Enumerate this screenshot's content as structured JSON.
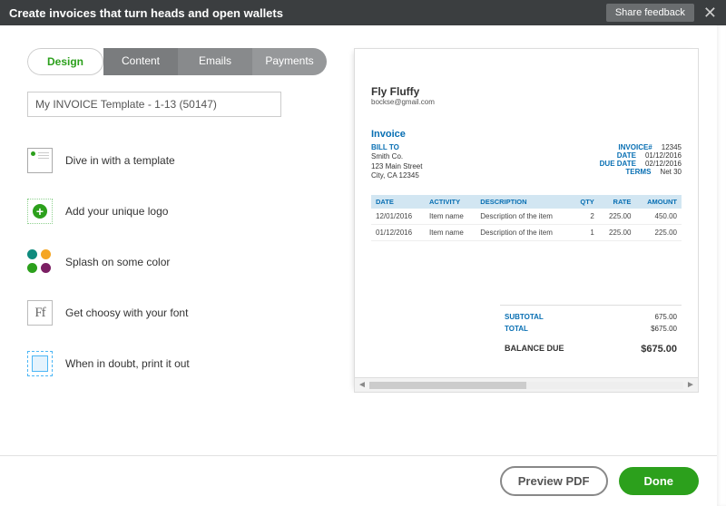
{
  "header": {
    "title": "Create invoices that turn heads and open wallets",
    "share_label": "Share feedback"
  },
  "tabs": [
    "Design",
    "Content",
    "Emails",
    "Payments"
  ],
  "template_name": "My INVOICE Template - 1-13 (50147)",
  "options": [
    {
      "label": "Dive in with a template"
    },
    {
      "label": "Add your unique logo"
    },
    {
      "label": "Splash on some color"
    },
    {
      "label": "Get choosy with your font"
    },
    {
      "label": "When in doubt, print it out"
    }
  ],
  "colors": {
    "c1": "#0f8b7e",
    "c2": "#f5a623",
    "c3": "#2ca01c",
    "c4": "#7b1f63"
  },
  "preview": {
    "company": "Fly Fluffy",
    "email": "bockse@gmail.com",
    "doc_label": "Invoice",
    "billto_label": "BILL TO",
    "billto": [
      "Smith Co.",
      "123 Main Street",
      "City, CA 12345"
    ],
    "meta": [
      {
        "label": "INVOICE#",
        "value": "12345"
      },
      {
        "label": "DATE",
        "value": "01/12/2016"
      },
      {
        "label": "DUE DATE",
        "value": "02/12/2016"
      },
      {
        "label": "TERMS",
        "value": "Net 30"
      }
    ],
    "cols": [
      "DATE",
      "ACTIVITY",
      "DESCRIPTION",
      "QTY",
      "RATE",
      "AMOUNT"
    ],
    "rows": [
      {
        "date": "12/01/2016",
        "activity": "Item name",
        "desc": "Description of the item",
        "qty": "2",
        "rate": "225.00",
        "amount": "450.00"
      },
      {
        "date": "01/12/2016",
        "activity": "Item name",
        "desc": "Description of the item",
        "qty": "1",
        "rate": "225.00",
        "amount": "225.00"
      }
    ],
    "subtotal_label": "SUBTOTAL",
    "subtotal": "675.00",
    "total_label": "TOTAL",
    "total": "$675.00",
    "balance_label": "BALANCE DUE",
    "balance": "$675.00"
  },
  "footer": {
    "preview_label": "Preview PDF",
    "done_label": "Done"
  }
}
